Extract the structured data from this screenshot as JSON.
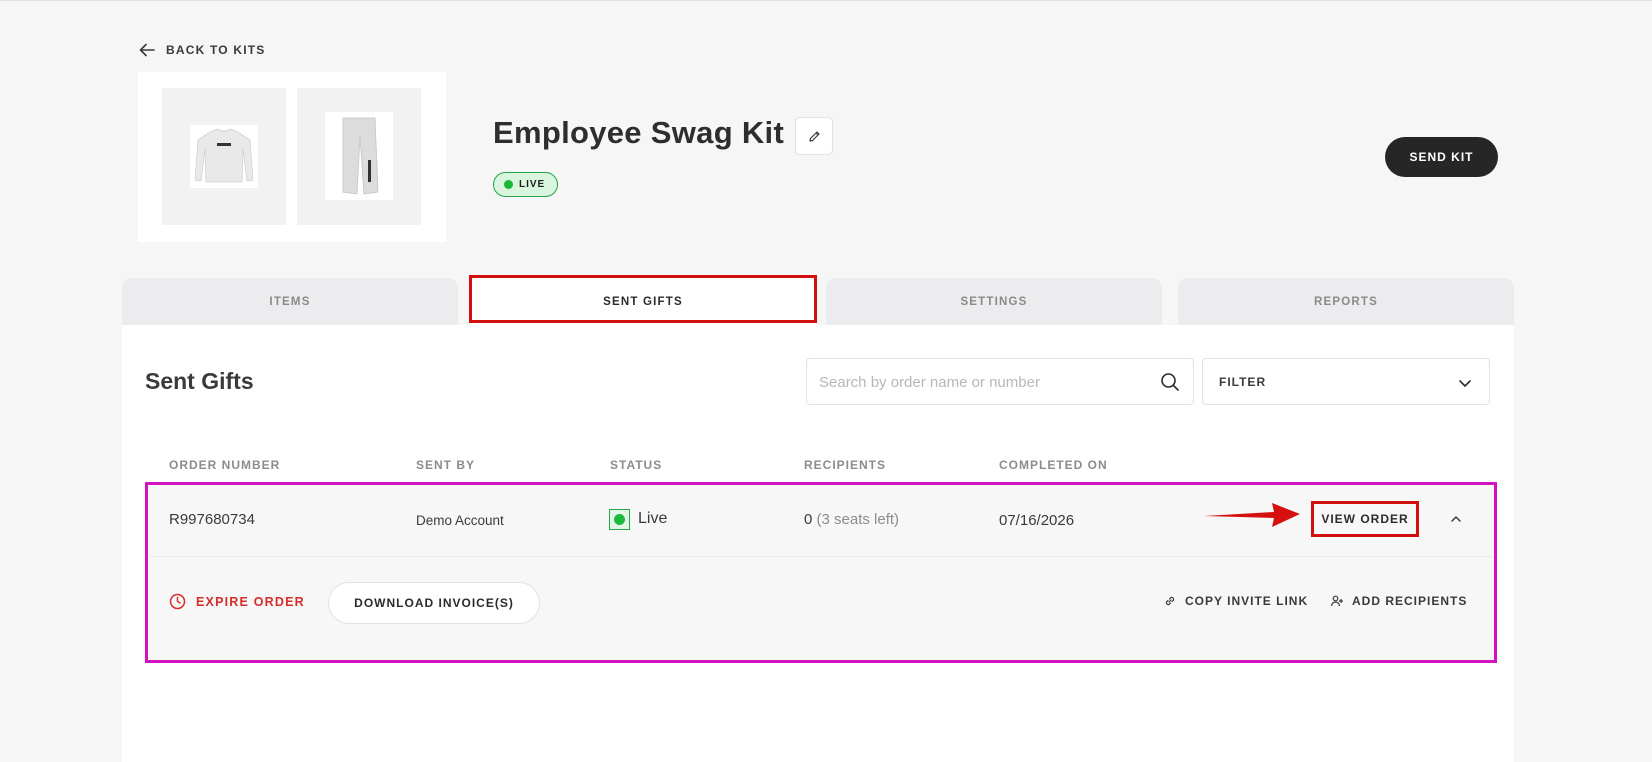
{
  "header": {
    "back_label": "BACK TO KITS",
    "kit_title": "Employee Swag Kit",
    "status_badge": "LIVE",
    "send_kit_label": "SEND KIT"
  },
  "tabs": [
    {
      "label": "ITEMS"
    },
    {
      "label": "SENT GIFTS"
    },
    {
      "label": "SETTINGS"
    },
    {
      "label": "REPORTS"
    }
  ],
  "sent_gifts": {
    "title": "Sent Gifts",
    "search_placeholder": "Search by order name or number",
    "filter_label": "FILTER",
    "columns": [
      "ORDER NUMBER",
      "SENT BY",
      "STATUS",
      "RECIPIENTS",
      "COMPLETED ON"
    ],
    "rows": [
      {
        "order_number": "R997680734",
        "sent_by": "Demo Account",
        "status": "Live",
        "recipients_count": "0",
        "recipients_seats": "(3 seats left)",
        "completed_on": "07/16/2026",
        "view_order_label": "VIEW ORDER",
        "expire_label": "EXPIRE ORDER",
        "download_label": "DOWNLOAD INVOICE(S)",
        "copy_invite_label": "COPY INVITE LINK",
        "add_recipients_label": "ADD RECIPIENTS"
      }
    ]
  },
  "colors": {
    "accent_dark": "#262626",
    "live_green": "#1db83e",
    "expire_red": "#d62c2c",
    "annotation_red": "#d20f0f",
    "annotation_magenta": "#d312c0"
  }
}
